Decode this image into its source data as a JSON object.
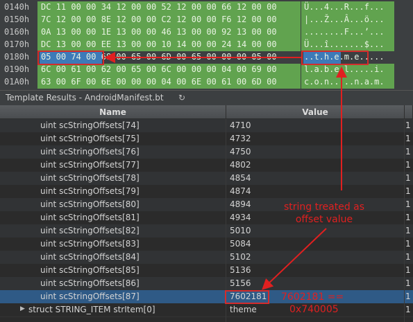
{
  "hex_view": {
    "rows": [
      {
        "addr": "0140h",
        "bytes": "DC 11 00 00 34 12 00 00 52 12 00 00 66 12 00 00",
        "ascii": "Ü...4...R...f..."
      },
      {
        "addr": "0150h",
        "bytes": "7C 12 00 00 8E 12 00 00 C2 12 00 00 F6 12 00 00",
        "ascii": "|...Ž...Â...ö..."
      },
      {
        "addr": "0160h",
        "bytes": "0A 13 00 00 1E 13 00 00 46 13 00 00 92 13 00 00",
        "ascii": "........F...’..."
      },
      {
        "addr": "0170h",
        "bytes": "DC 13 00 00 EE 13 00 00 10 14 00 00 24 14 00 00",
        "ascii": "Ü...î.......$..."
      },
      {
        "addr": "0180h",
        "bytes": "05 00 74 00 68 00 65 00 6D 00 65 00 00 00 05 00",
        "ascii": "..t.h.e.m.e....."
      },
      {
        "addr": "0190h",
        "bytes": "6C 00 61 00 62 00 65 00 6C 00 00 00 04 00 69 00",
        "ascii": "l.a.b.e.l.....i."
      },
      {
        "addr": "01A0h",
        "bytes": "63 00 6F 00 6E 00 00 00 04 00 6E 00 61 00 6D 00",
        "ascii": "c.o.n.....n.a.m."
      }
    ]
  },
  "template_results": {
    "title": "Template Results - AndroidManifest.bt",
    "refresh_icon": "refresh-icon",
    "columns": {
      "name": "Name",
      "value": "Value"
    },
    "rows": [
      {
        "name": "uint scStringOffsets[74]",
        "value": "4710",
        "extra": "1"
      },
      {
        "name": "uint scStringOffsets[75]",
        "value": "4732",
        "extra": "1"
      },
      {
        "name": "uint scStringOffsets[76]",
        "value": "4750",
        "extra": "1"
      },
      {
        "name": "uint scStringOffsets[77]",
        "value": "4802",
        "extra": "1"
      },
      {
        "name": "uint scStringOffsets[78]",
        "value": "4854",
        "extra": "1"
      },
      {
        "name": "uint scStringOffsets[79]",
        "value": "4874",
        "extra": "1"
      },
      {
        "name": "uint scStringOffsets[80]",
        "value": "4894",
        "extra": "1"
      },
      {
        "name": "uint scStringOffsets[81]",
        "value": "4934",
        "extra": "1"
      },
      {
        "name": "uint scStringOffsets[82]",
        "value": "5010",
        "extra": "1"
      },
      {
        "name": "uint scStringOffsets[83]",
        "value": "5084",
        "extra": "1"
      },
      {
        "name": "uint scStringOffsets[84]",
        "value": "5102",
        "extra": "1"
      },
      {
        "name": "uint scStringOffsets[85]",
        "value": "5136",
        "extra": "1"
      },
      {
        "name": "uint scStringOffsets[86]",
        "value": "5156",
        "extra": "1"
      },
      {
        "name": "uint scStringOffsets[87]",
        "value": "7602181",
        "extra": "1"
      },
      {
        "name": "struct STRING_ITEM strItem[0]",
        "value": "theme",
        "extra": "1"
      }
    ]
  },
  "annotations": {
    "string_offset_line1": "string treated as",
    "string_offset_line2": "offset value",
    "value_eq_line1": "7602181 ==",
    "value_eq_line2": "0x740005",
    "color": "#e02020"
  },
  "colors": {
    "hex_green": "#61a34f",
    "selection_blue": "#3d7ab8",
    "highlight_red": "#d42c2c",
    "row_selected": "#2f5a86"
  }
}
